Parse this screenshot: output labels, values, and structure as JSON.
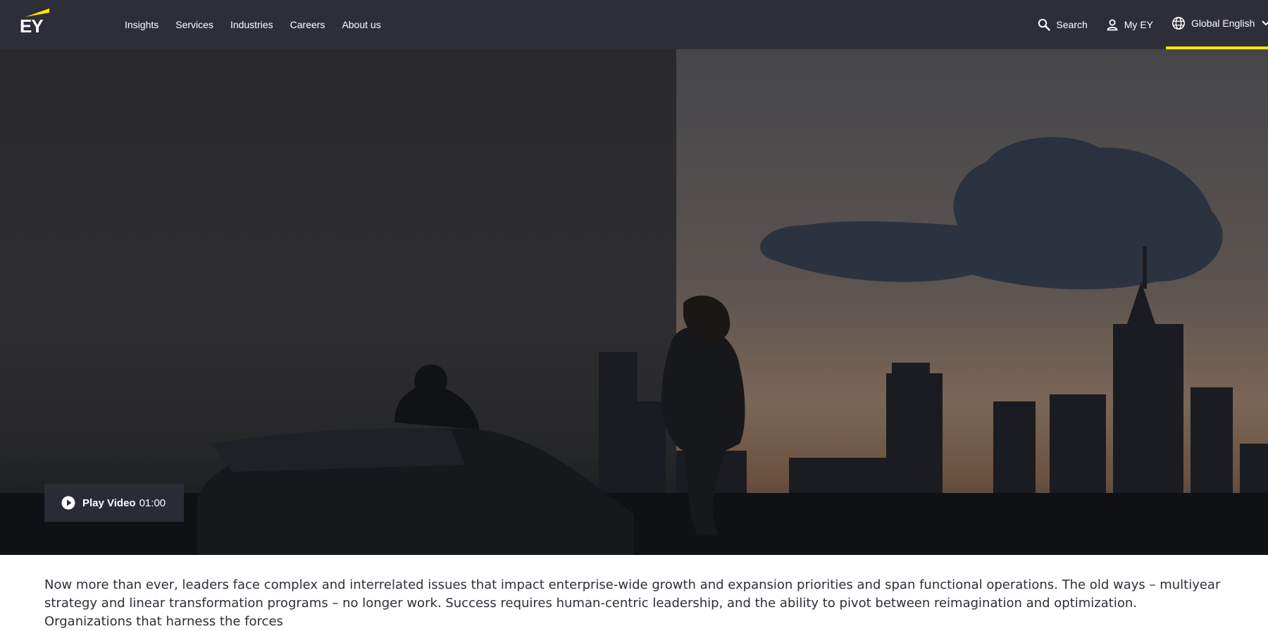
{
  "brand": {
    "logo_text": "EY",
    "accent_color": "#ffe600",
    "nav_bg": "#2e2e38"
  },
  "nav": {
    "items": [
      "Insights",
      "Services",
      "Industries",
      "Careers",
      "About us"
    ]
  },
  "utility": {
    "search_label": "Search",
    "myey_label": "My EY",
    "language_label": "Global English",
    "icons": [
      "search-icon",
      "user-icon",
      "globe-icon",
      "chevron-down-icon"
    ]
  },
  "hero": {
    "play_label": "Play Video",
    "duration": "01:00",
    "play_icon": "play-circle-icon"
  },
  "intro": {
    "text": "Now more than ever, leaders face complex and interrelated issues that impact enterprise-wide growth and expansion priorities and span functional operations. The old ways – multiyear strategy and linear transformation programs – no longer work. Success requires human-centric leadership, and the ability to pivot between reimagination and optimization. Organizations that harness the forces"
  }
}
